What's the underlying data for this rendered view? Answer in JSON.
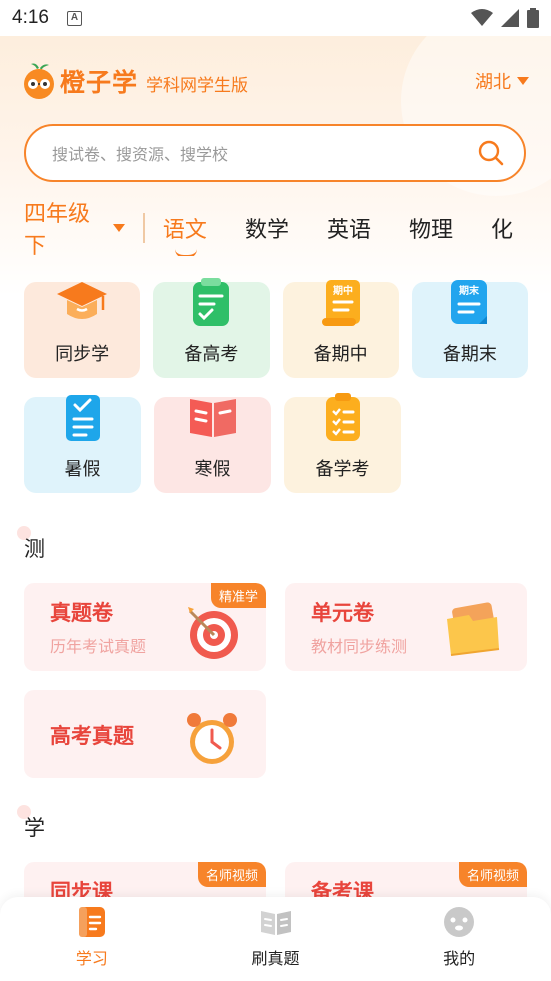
{
  "status_bar": {
    "time": "4:16",
    "notif_icon_letter": "A"
  },
  "header": {
    "brand": "橙子学",
    "brand_sub": "学科网学生版",
    "region": "湖北"
  },
  "search": {
    "placeholder": "搜试卷、搜资源、搜学校"
  },
  "subject_bar": {
    "grade": "四年级下",
    "tabs": [
      {
        "label": "语文",
        "active": true
      },
      {
        "label": "数学"
      },
      {
        "label": "英语"
      },
      {
        "label": "物理"
      },
      {
        "label": "化"
      }
    ]
  },
  "categories": [
    {
      "label": "同步学",
      "icon": "graduation-cap-icon"
    },
    {
      "label": "备高考",
      "icon": "notepad-check-icon"
    },
    {
      "label": "备期中",
      "icon": "midterm-scroll-icon",
      "icon_text": "期中"
    },
    {
      "label": "备期末",
      "icon": "final-doc-icon",
      "icon_text": "期末"
    },
    {
      "label": "暑假",
      "icon": "summer-checklist-icon"
    },
    {
      "label": "寒假",
      "icon": "winter-book-icon"
    },
    {
      "label": "备学考",
      "icon": "clipboard-list-icon"
    }
  ],
  "test_section": {
    "title": "测",
    "cards": [
      {
        "title": "真题卷",
        "subtitle": "历年考试真题",
        "badge": "精准学",
        "art": "target-dart-icon"
      },
      {
        "title": "单元卷",
        "subtitle": "教材同步练测",
        "art": "folder-icon"
      },
      {
        "title": "高考真题",
        "art": "alarm-clock-icon"
      }
    ]
  },
  "learn_section": {
    "title": "学",
    "cards": [
      {
        "title": "同步课",
        "badge": "名师视频"
      },
      {
        "title": "备考课",
        "badge": "名师视频"
      }
    ]
  },
  "bottom_nav": [
    {
      "label": "学习",
      "icon": "study-book-icon",
      "active": true
    },
    {
      "label": "刷真题",
      "icon": "open-book-icon"
    },
    {
      "label": "我的",
      "icon": "profile-face-icon"
    }
  ],
  "colors": {
    "accent": "#f77a1d",
    "feature_title": "#e8453c",
    "badge": "#f7842a"
  }
}
